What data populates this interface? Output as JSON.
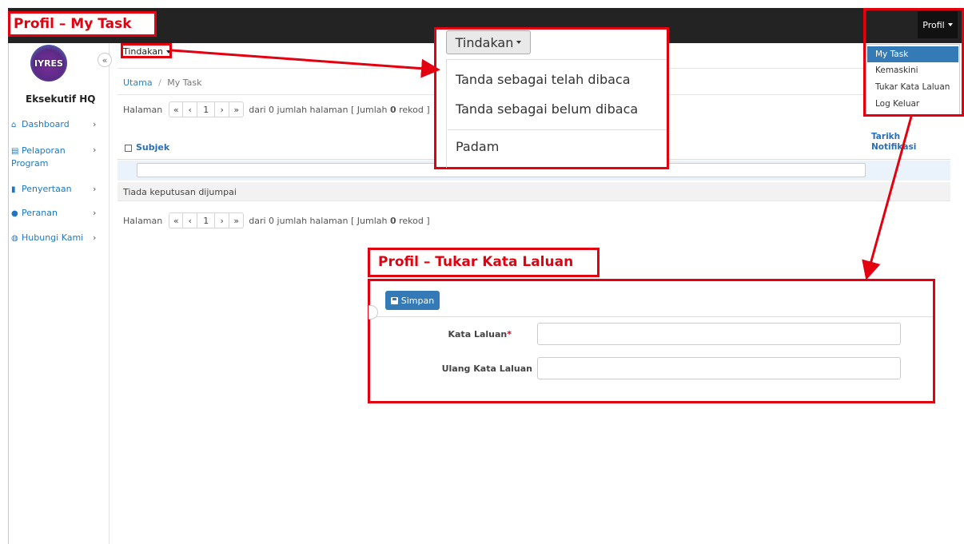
{
  "topbar": {
    "profil_label": "Profil"
  },
  "sidebar": {
    "logo_text": "IYRES",
    "collapse_icon": "«",
    "org_name": "Eksekutif HQ",
    "items": [
      {
        "label": "Dashboard",
        "icon": "home-icon"
      },
      {
        "label": "Pelaporan Program",
        "icon": "book-icon"
      },
      {
        "label": "Penyertaan",
        "icon": "clipboard-icon"
      },
      {
        "label": "Peranan",
        "icon": "user-icon"
      },
      {
        "label": "Hubungi Kami",
        "icon": "chat-icon"
      }
    ]
  },
  "main": {
    "tindakan_label": "Tindakan",
    "breadcrumb": {
      "home": "Utama",
      "separator": "/",
      "current": "My Task"
    },
    "pager": {
      "prefix": "Halaman",
      "first": "«",
      "prev": "‹",
      "page": "1",
      "next": "›",
      "last": "»",
      "suffix_a": "dari 0 jumlah halaman [ Jumlah ",
      "count": "0",
      "suffix_b": " rekod ]"
    },
    "table": {
      "col_subject": "Subjek",
      "col_date": "Tarikh Notifikasi",
      "empty_message": "Tiada keputusan dijumpai"
    }
  },
  "tindakan_dropdown": {
    "button_label": "Tindakan",
    "items": [
      "Tanda sebagai telah dibaca",
      "Tanda sebagai belum dibaca",
      "Padam"
    ]
  },
  "profil_dropdown": {
    "items": [
      "My Task",
      "Kemaskini",
      "Tukar Kata Laluan",
      "Log Keluar"
    ]
  },
  "labels": {
    "my_task": "Profil – My Task",
    "tukar_kata_laluan": "Profil – Tukar Kata Laluan"
  },
  "tukar_kata_laluan_form": {
    "save_label": "Simpan",
    "password_label": "Kata Laluan",
    "required_mark": "*",
    "repeat_password_label": "Ulang Kata Laluan"
  },
  "colors": {
    "accent": "#337ab7",
    "callout": "#e3000f",
    "topbar": "#232323"
  }
}
